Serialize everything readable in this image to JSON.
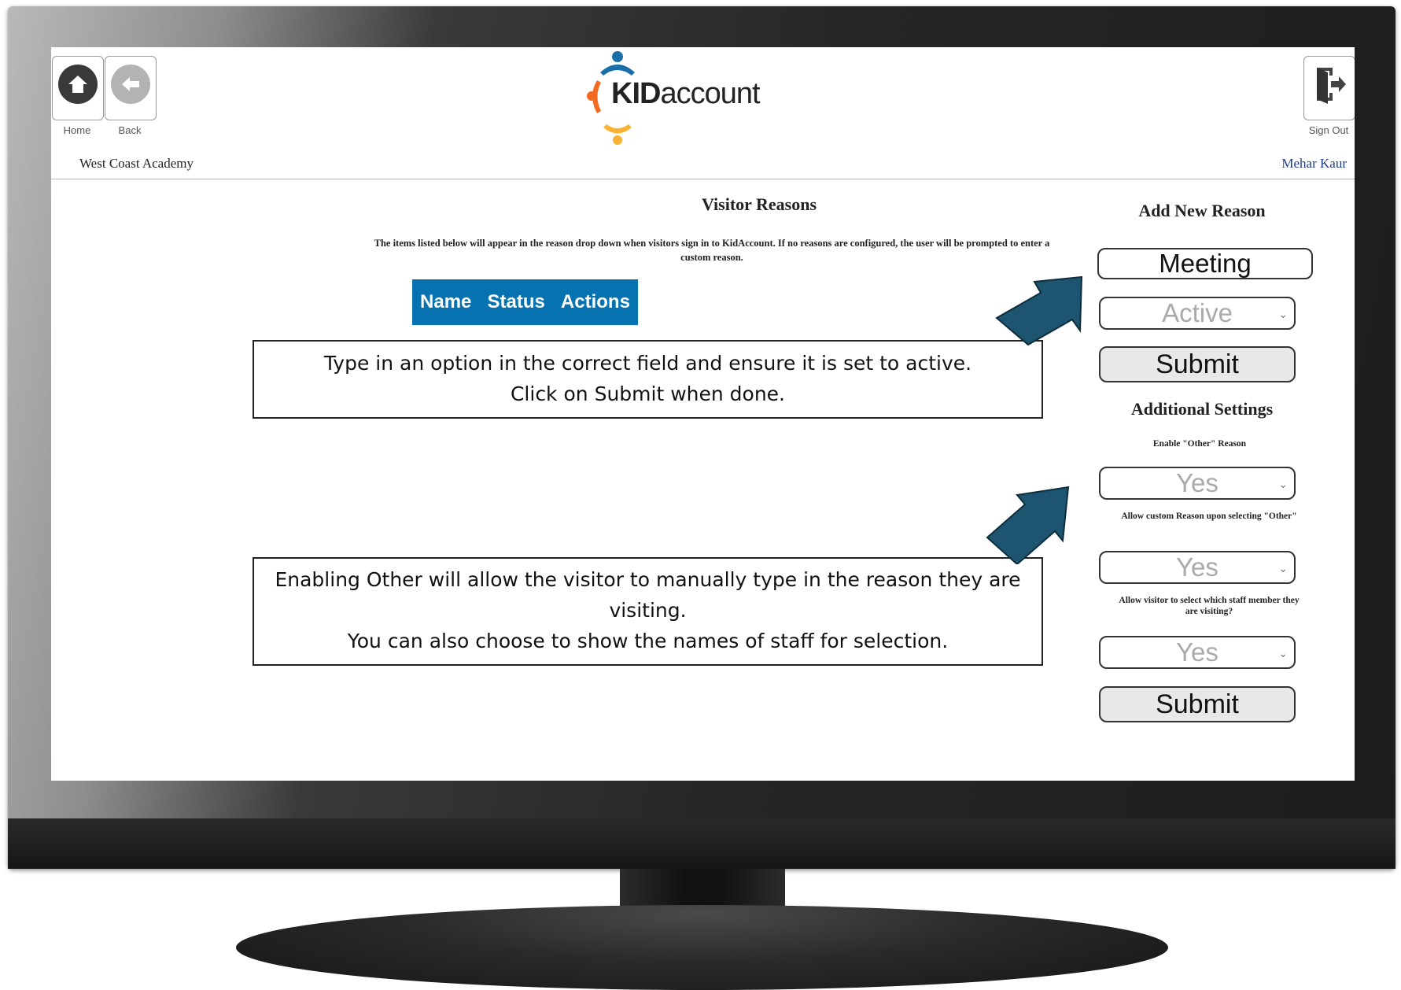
{
  "header": {
    "home_label": "Home",
    "back_label": "Back",
    "signout_label": "Sign Out",
    "school_name": "West Coast Academy",
    "user_name": "Mehar Kaur",
    "logo": {
      "part1": "KID",
      "part2": "account"
    }
  },
  "main": {
    "title": "Visitor Reasons",
    "description": "The items listed below will appear in the reason drop down when visitors sign in to KidAccount. If no reasons are configured, the user will be prompted to enter a custom reason.",
    "table_columns": [
      "Name",
      "Status",
      "Actions"
    ]
  },
  "callouts": {
    "first": {
      "line1": "Type in an option in the correct field and ensure it is set to active.",
      "line2": "Click on Submit when done."
    },
    "second": {
      "line1": "Enabling Other will allow the visitor to manually type in the reason they are visiting.",
      "line2": "You can also choose to show the names of staff for selection."
    }
  },
  "add_reason": {
    "title": "Add New Reason",
    "name_value": "Meeting",
    "status_value": "Active",
    "submit_label": "Submit"
  },
  "additional_settings": {
    "title": "Additional Settings",
    "enable_other_label": "Enable \"Other\" Reason",
    "enable_other_value": "Yes",
    "allow_custom_label": "Allow custom Reason upon selecting \"Other\"",
    "allow_custom_value": "Yes",
    "allow_staff_label": "Allow visitor to select which staff member they are visiting?",
    "allow_staff_value": "Yes",
    "submit_label": "Submit"
  },
  "colors": {
    "table_header": "#0673b0",
    "arrow": "#1d5470",
    "logo_blue": "#1a6fa8",
    "logo_orange": "#f26b21",
    "logo_yellow": "#f9b233"
  }
}
